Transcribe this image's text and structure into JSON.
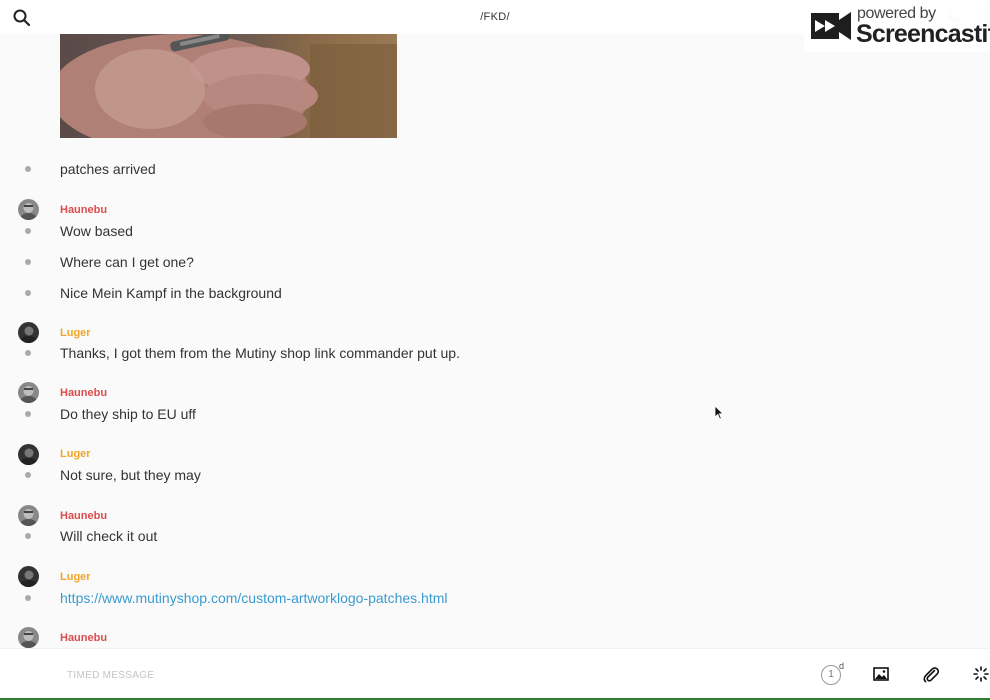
{
  "header": {
    "title": "/FKD/",
    "search_icon": "search-icon",
    "call_icon": "phone-icon",
    "info_icon": "info-icon"
  },
  "watermark": {
    "powered_by": "powered by",
    "brand": "Screencastify"
  },
  "messages": [
    {
      "type": "message",
      "text": "patches arrived"
    },
    {
      "type": "author",
      "name": "Haunebu",
      "color": "#dd4c4c"
    },
    {
      "type": "message",
      "text": "Wow based"
    },
    {
      "type": "message",
      "text": "Where can I get one?"
    },
    {
      "type": "message",
      "text": "Nice Mein Kampf in the background"
    },
    {
      "type": "author",
      "name": "Luger",
      "color": "#f0a52a"
    },
    {
      "type": "message",
      "text": "Thanks, I got them from the Mutiny shop link commander put up."
    },
    {
      "type": "author",
      "name": "Haunebu",
      "color": "#dd4c4c"
    },
    {
      "type": "message",
      "text": "Do they ship to EU uff"
    },
    {
      "type": "author",
      "name": "Luger",
      "color": "#f0a52a"
    },
    {
      "type": "message",
      "text": "Not sure, but they may"
    },
    {
      "type": "author",
      "name": "Haunebu",
      "color": "#dd4c4c"
    },
    {
      "type": "message",
      "text": "Will check it out"
    },
    {
      "type": "author",
      "name": "Luger",
      "color": "#f0a52a"
    },
    {
      "type": "link",
      "text": "https://www.mutinyshop.com/custom-artworklogo-patches.html"
    },
    {
      "type": "author",
      "name": "Haunebu",
      "color": "#dd4c4c"
    }
  ],
  "composer": {
    "placeholder": "TIMED MESSAGE",
    "value": "",
    "timer_value": "1",
    "timer_unit": "d",
    "image_icon": "image-icon",
    "attach_icon": "paperclip-icon",
    "spinner_icon": "loading-spinner-icon"
  },
  "colors": {
    "author_haunebu": "#dd4c4c",
    "author_luger": "#f0a52a",
    "link": "#3a9bd0"
  }
}
